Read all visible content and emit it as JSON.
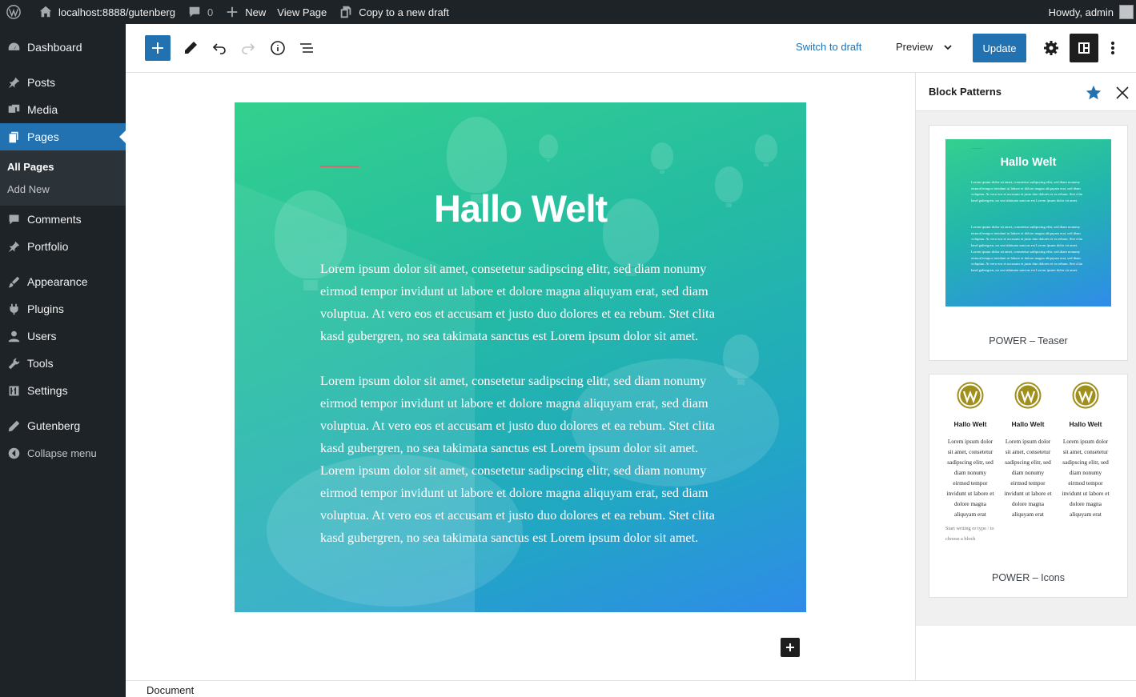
{
  "admin_bar": {
    "site_url": "localhost:8888/gutenberg",
    "comments_count": "0",
    "new_label": "New",
    "view_page_label": "View Page",
    "copy_draft_label": "Copy to a new draft",
    "greeting": "Howdy, admin"
  },
  "sidebar": {
    "items": [
      {
        "label": "Dashboard",
        "icon": "dashboard-icon"
      },
      {
        "label": "Posts",
        "icon": "pin-icon"
      },
      {
        "label": "Media",
        "icon": "media-icon"
      },
      {
        "label": "Pages",
        "icon": "pages-icon"
      },
      {
        "label": "Comments",
        "icon": "comment-icon"
      },
      {
        "label": "Portfolio",
        "icon": "pin-icon"
      },
      {
        "label": "Appearance",
        "icon": "brush-icon"
      },
      {
        "label": "Plugins",
        "icon": "plug-icon"
      },
      {
        "label": "Users",
        "icon": "user-icon"
      },
      {
        "label": "Tools",
        "icon": "wrench-icon"
      },
      {
        "label": "Settings",
        "icon": "sliders-icon"
      },
      {
        "label": "Gutenberg",
        "icon": "pencil-icon"
      },
      {
        "label": "Collapse menu",
        "icon": "collapse-icon"
      }
    ],
    "submenu": [
      "All Pages",
      "Add New"
    ]
  },
  "header": {
    "switch_to_draft": "Switch to draft",
    "preview": "Preview",
    "update": "Update"
  },
  "cover": {
    "title": "Hallo Welt",
    "paragraph1": "Lorem ipsum dolor sit amet, consetetur sadipscing elitr, sed diam nonumy eirmod tempor invidunt ut labore et dolore magna aliquyam erat, sed diam voluptua. At vero eos et accusam et justo duo dolores et ea rebum. Stet clita kasd gubergren, no sea takimata sanctus est Lorem ipsum dolor sit amet.",
    "paragraph2": "Lorem ipsum dolor sit amet, consetetur sadipscing elitr, sed diam nonumy eirmod tempor invidunt ut labore et dolore magna aliquyam erat, sed diam voluptua. At vero eos et accusam et justo duo dolores et ea rebum. Stet clita kasd gubergren, no sea takimata sanctus est Lorem ipsum dolor sit amet. Lorem ipsum dolor sit amet, consetetur sadipscing elitr, sed diam nonumy eirmod tempor invidunt ut labore et dolore magna aliquyam erat, sed diam voluptua. At vero eos et accusam et justo duo dolores et ea rebum. Stet clita kasd gubergren, no sea takimata sanctus est Lorem ipsum dolor sit amet."
  },
  "patterns_panel": {
    "title": "Block Patterns",
    "patterns": [
      {
        "label": "POWER – Teaser",
        "preview_title": "Hallo Welt",
        "preview_p1": "Lorem ipsum dolor sit amet, consetetur sadipscing elitr, sed diam nonumy eirmod tempor invidunt ut labore et dolore magna aliquyam erat, sed diam voluptua. At vero eos et accusam et justo duo dolores et ea rebum. Stet clita kasd gubergren, no sea takimata sanctus est Lorem ipsum dolor sit amet.",
        "preview_p2": "Lorem ipsum dolor sit amet, consetetur sadipscing elitr, sed diam nonumy eirmod tempor invidunt ut labore et dolore magna aliquyam erat, sed diam voluptua. At vero eos et accusam et justo duo dolores et ea rebum. Stet clita kasd gubergren, no sea takimata sanctus est Lorem ipsum dolor sit amet. Lorem ipsum dolor sit amet, consetetur sadipscing elitr, sed diam nonumy eirmod tempor invidunt ut labore et dolore magna aliquyam erat, sed diam voluptua. At vero eos et accusam et justo duo dolores et ea rebum. Stet clita kasd gubergren, no sea takimata sanctus est Lorem ipsum dolor sit amet."
      },
      {
        "label": "POWER – Icons",
        "columns": [
          {
            "title": "Hallo Welt",
            "text": "Lorem ipsum dolor sit amet, consetetur sadipscing elitr, sed diam nonumy eirmod tempor invidunt ut labore et dolore magna aliquyam erat"
          },
          {
            "title": "Hallo Welt",
            "text": "Lorem ipsum dolor sit amet, consetetur sadipscing elitr, sed diam nonumy eirmod tempor invidunt ut labore et dolore magna aliquyam erat"
          },
          {
            "title": "Hallo Welt",
            "text": "Lorem ipsum dolor sit amet, consetetur sadipscing elitr, sed diam nonumy eirmod tempor invidunt ut labore et dolore magna aliquyam erat"
          }
        ],
        "hint": "Start writing or type / to choose a block"
      }
    ]
  },
  "footer": {
    "breadcrumb": "Document"
  },
  "colors": {
    "accent": "#2271b1",
    "admin_dark": "#1d2327",
    "wp_logo": "#a08f1c"
  }
}
